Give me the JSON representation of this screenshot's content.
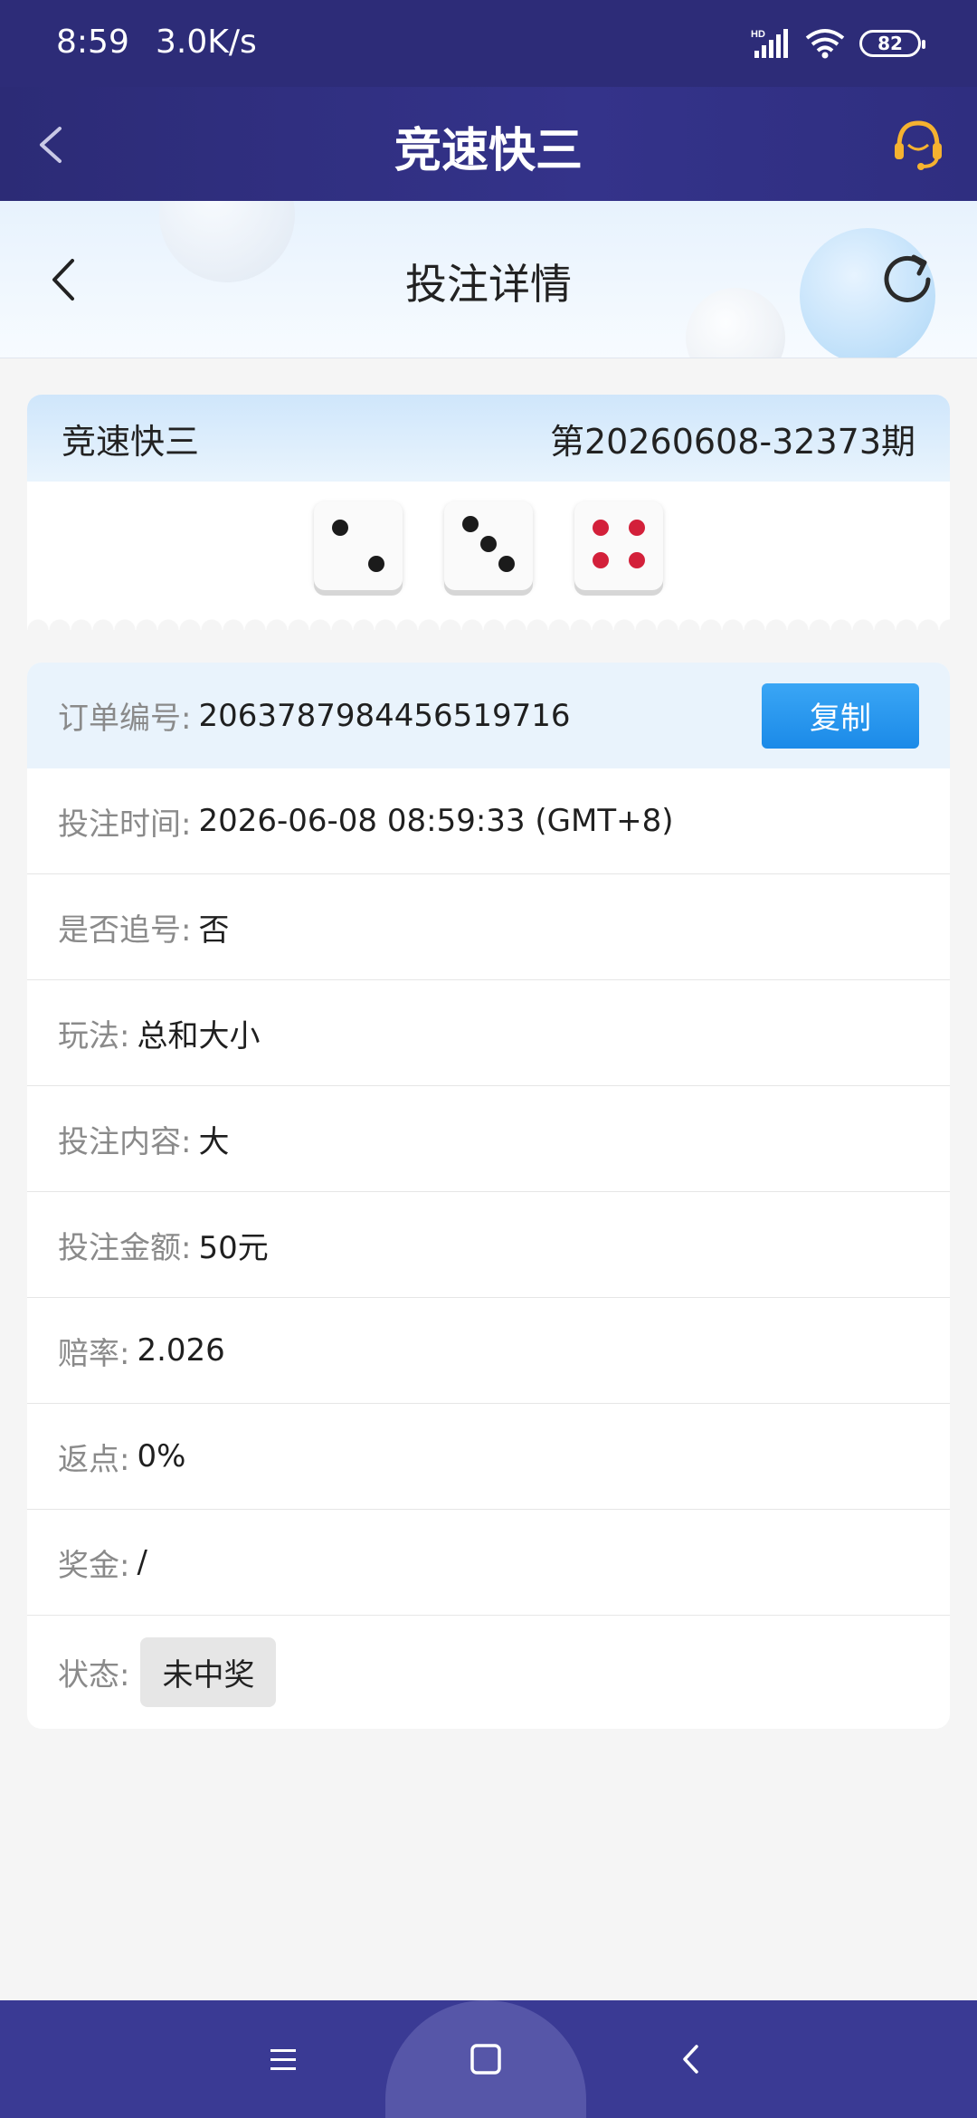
{
  "status_bar": {
    "time": "8:59",
    "speed": "3.0K/s",
    "battery": "82",
    "icons": [
      "hd-signal-icon",
      "wifi-icon",
      "battery-icon"
    ]
  },
  "app_header": {
    "title": "竞速快三",
    "icons": [
      "back-arrow-icon",
      "headset-support-icon"
    ]
  },
  "sub_header": {
    "title": "投注详情",
    "icons": [
      "back-chevron-icon",
      "refresh-icon"
    ]
  },
  "result_card": {
    "game_name": "竞速快三",
    "period": "第20260608-32373期",
    "dice": [
      2,
      3,
      4
    ]
  },
  "details": {
    "order_no_label": "订单编号:",
    "order_no": "2063787984456519716",
    "copy_label": "复制",
    "bet_time_label": "投注时间:",
    "bet_time": "2026-06-08 08:59:33 (GMT+8)",
    "chase_label": "是否追号:",
    "chase": "否",
    "play_label": "玩法:",
    "play": "总和大小",
    "content_label": "投注内容:",
    "content": "大",
    "amount_label": "投注金额:",
    "amount": "50元",
    "odds_label": "赔率:",
    "odds": "2.026",
    "rebate_label": "返点:",
    "rebate": "0%",
    "prize_label": "奖金:",
    "prize": "/",
    "status_label": "状态:",
    "status": "未中奖"
  },
  "colors": {
    "header_bg": "#2d2c78",
    "accent_blue": "#1b8ae8",
    "nav_bg": "#3a3a94"
  },
  "nav_bar": {
    "icons": [
      "menu-icon",
      "home-square-icon",
      "back-nav-icon"
    ]
  }
}
